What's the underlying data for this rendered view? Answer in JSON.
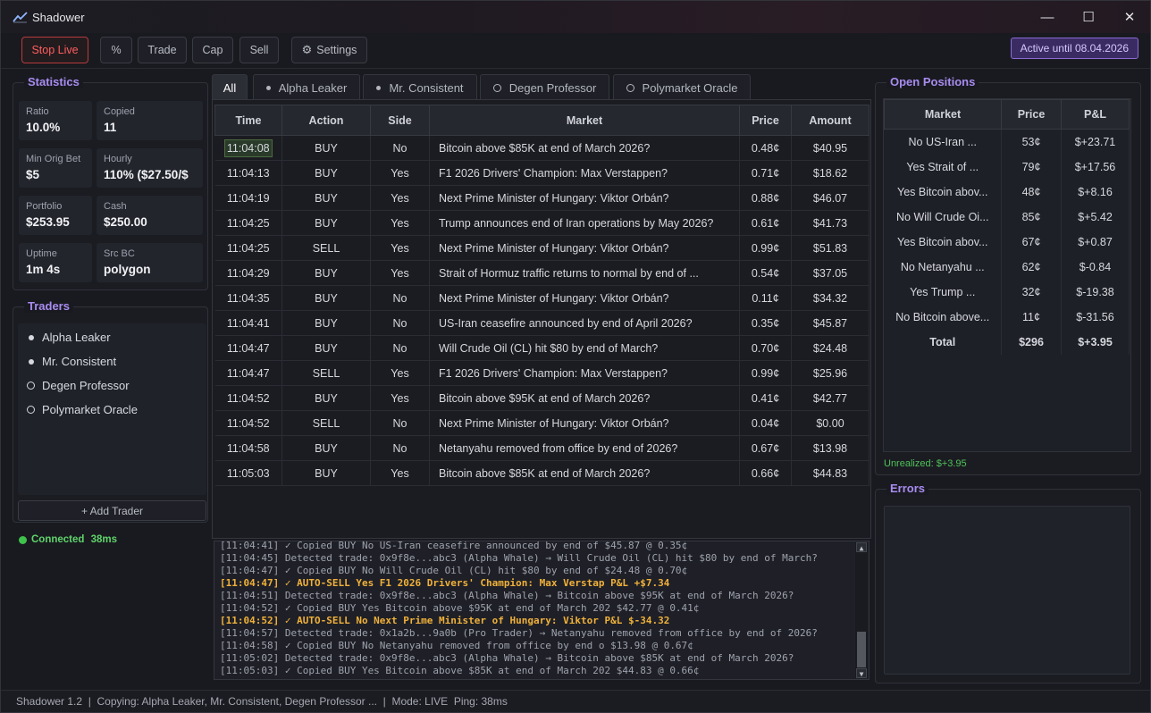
{
  "window": {
    "title": "Shadower",
    "controls": {
      "minimize": "—",
      "maximize": "☐",
      "close": "✕"
    }
  },
  "toolbar": {
    "stop_live": "Stop Live",
    "percent": "%",
    "trade": "Trade",
    "cap": "Cap",
    "sell": "Sell",
    "settings": "Settings",
    "settings_icon": "⚙",
    "active_badge": "Active until 08.04.2026"
  },
  "statistics": {
    "title": "Statistics",
    "items": [
      {
        "label": "Ratio",
        "value": "10.0%"
      },
      {
        "label": "Copied",
        "value": "11"
      },
      {
        "label": "Min Orig Bet",
        "value": "$5"
      },
      {
        "label": "Hourly",
        "value": "110% ($27.50/$"
      },
      {
        "label": "Portfolio",
        "value": "$253.95"
      },
      {
        "label": "Cash",
        "value": "$250.00"
      },
      {
        "label": "Uptime",
        "value": "1m 4s"
      },
      {
        "label": "Src BC",
        "value": "polygon"
      }
    ]
  },
  "traders": {
    "title": "Traders",
    "items": [
      {
        "name": "Alpha Leaker",
        "marker": "filled"
      },
      {
        "name": "Mr. Consistent",
        "marker": "filled"
      },
      {
        "name": "Degen Professor",
        "marker": "ring"
      },
      {
        "name": "Polymarket Oracle",
        "marker": "ring"
      }
    ],
    "add_button": "+ Add Trader"
  },
  "connection": {
    "status": "Connected",
    "ping": "38ms"
  },
  "tabs": [
    {
      "label": "All",
      "marker": "none"
    },
    {
      "label": "Alpha Leaker",
      "marker": "filled"
    },
    {
      "label": "Mr. Consistent",
      "marker": "filled"
    },
    {
      "label": "Degen Professor",
      "marker": "ring"
    },
    {
      "label": "Polymarket Oracle",
      "marker": "ring"
    }
  ],
  "trades": {
    "headers": [
      "Time",
      "Action",
      "Side",
      "Market",
      "Price",
      "Amount"
    ],
    "rows": [
      {
        "time": "11:04:08",
        "action": "BUY",
        "side": "No",
        "market": "Bitcoin above $85K at end of March 2026?",
        "price": "0.48¢",
        "amount": "$40.95"
      },
      {
        "time": "11:04:13",
        "action": "BUY",
        "side": "Yes",
        "market": "F1 2026 Drivers' Champion: Max Verstappen?",
        "price": "0.71¢",
        "amount": "$18.62"
      },
      {
        "time": "11:04:19",
        "action": "BUY",
        "side": "Yes",
        "market": "Next Prime Minister of Hungary: Viktor Orbán?",
        "price": "0.88¢",
        "amount": "$46.07"
      },
      {
        "time": "11:04:25",
        "action": "BUY",
        "side": "Yes",
        "market": "Trump announces end of Iran operations by May 2026?",
        "price": "0.61¢",
        "amount": "$41.73"
      },
      {
        "time": "11:04:25",
        "action": "SELL",
        "side": "Yes",
        "market": "Next Prime Minister of Hungary: Viktor Orbán?",
        "price": "0.99¢",
        "amount": "$51.83"
      },
      {
        "time": "11:04:29",
        "action": "BUY",
        "side": "Yes",
        "market": "Strait of Hormuz traffic returns to normal by end of ...",
        "price": "0.54¢",
        "amount": "$37.05"
      },
      {
        "time": "11:04:35",
        "action": "BUY",
        "side": "No",
        "market": "Next Prime Minister of Hungary: Viktor Orbán?",
        "price": "0.11¢",
        "amount": "$34.32"
      },
      {
        "time": "11:04:41",
        "action": "BUY",
        "side": "No",
        "market": "US-Iran ceasefire announced by end of April 2026?",
        "price": "0.35¢",
        "amount": "$45.87"
      },
      {
        "time": "11:04:47",
        "action": "BUY",
        "side": "No",
        "market": "Will Crude Oil (CL) hit $80 by end of March?",
        "price": "0.70¢",
        "amount": "$24.48"
      },
      {
        "time": "11:04:47",
        "action": "SELL",
        "side": "Yes",
        "market": "F1 2026 Drivers' Champion: Max Verstappen?",
        "price": "0.99¢",
        "amount": "$25.96"
      },
      {
        "time": "11:04:52",
        "action": "BUY",
        "side": "Yes",
        "market": "Bitcoin above $95K at end of March 2026?",
        "price": "0.41¢",
        "amount": "$42.77"
      },
      {
        "time": "11:04:52",
        "action": "SELL",
        "side": "No",
        "market": "Next Prime Minister of Hungary: Viktor Orbán?",
        "price": "0.04¢",
        "amount": "$0.00"
      },
      {
        "time": "11:04:58",
        "action": "BUY",
        "side": "No",
        "market": "Netanyahu removed from office by end of 2026?",
        "price": "0.67¢",
        "amount": "$13.98"
      },
      {
        "time": "11:05:03",
        "action": "BUY",
        "side": "Yes",
        "market": "Bitcoin above $85K at end of March 2026?",
        "price": "0.66¢",
        "amount": "$44.83"
      }
    ]
  },
  "log": [
    {
      "text": "[11:04:41] ✓ Copied BUY No US-Iran ceasefire announced by end of $45.87 @ 0.35¢",
      "highlight": false
    },
    {
      "text": "[11:04:45] Detected trade: 0x9f8e...abc3 (Alpha Whale) → Will Crude Oil (CL) hit $80 by end of March?",
      "highlight": false
    },
    {
      "text": "[11:04:47] ✓ Copied BUY No Will Crude Oil (CL) hit $80 by end of $24.48 @ 0.70¢",
      "highlight": false
    },
    {
      "text": "[11:04:47] ✓ AUTO-SELL Yes F1 2026 Drivers' Champion: Max Verstap P&L +$7.34",
      "highlight": true
    },
    {
      "text": "[11:04:51] Detected trade: 0x9f8e...abc3 (Alpha Whale) → Bitcoin above $95K at end of March 2026?",
      "highlight": false
    },
    {
      "text": "[11:04:52] ✓ Copied BUY Yes Bitcoin above $95K at end of March 202 $42.77 @ 0.41¢",
      "highlight": false
    },
    {
      "text": "[11:04:52] ✓ AUTO-SELL No Next Prime Minister of Hungary: Viktor P&L $-34.32",
      "highlight": true
    },
    {
      "text": "[11:04:57] Detected trade: 0x1a2b...9a0b (Pro Trader) → Netanyahu removed from office by end of 2026?",
      "highlight": false
    },
    {
      "text": "[11:04:58] ✓ Copied BUY No Netanyahu removed from office by end o $13.98 @ 0.67¢",
      "highlight": false
    },
    {
      "text": "[11:05:02] Detected trade: 0x9f8e...abc3 (Alpha Whale) → Bitcoin above $85K at end of March 2026?",
      "highlight": false
    },
    {
      "text": "[11:05:03] ✓ Copied BUY Yes Bitcoin above $85K at end of March 202 $44.83 @ 0.66¢",
      "highlight": false
    }
  ],
  "open_positions": {
    "title": "Open Positions",
    "headers": [
      "Market",
      "Price",
      "P&L"
    ],
    "rows": [
      {
        "market": "No US-Iran ...",
        "price": "53¢",
        "pnl": "$+23.71",
        "trend": "up"
      },
      {
        "market": "Yes Strait of ...",
        "price": "79¢",
        "pnl": "$+17.56",
        "trend": "up"
      },
      {
        "market": "Yes Bitcoin abov...",
        "price": "48¢",
        "pnl": "$+8.16",
        "trend": "up"
      },
      {
        "market": "No Will Crude Oi...",
        "price": "85¢",
        "pnl": "$+5.42",
        "trend": "up"
      },
      {
        "market": "Yes Bitcoin abov...",
        "price": "67¢",
        "pnl": "$+0.87",
        "trend": "up"
      },
      {
        "market": "No Netanyahu ...",
        "price": "62¢",
        "pnl": "$-0.84",
        "trend": "down"
      },
      {
        "market": "Yes Trump ...",
        "price": "32¢",
        "pnl": "$-19.38",
        "trend": "down"
      },
      {
        "market": "No Bitcoin above...",
        "price": "11¢",
        "pnl": "$-31.56",
        "trend": "down"
      }
    ],
    "total": {
      "label": "Total",
      "price": "$296",
      "pnl": "$+3.95"
    },
    "unrealized": "Unrealized: $+3.95"
  },
  "errors": {
    "title": "Errors"
  },
  "statusbar": {
    "text": "Shadower 1.2  |  Copying: Alpha Leaker, Mr. Consistent, Degen Professor ...  |  Mode: LIVE  Ping: 38ms"
  },
  "colors": {
    "accent": "#a88cf0",
    "buy": "#4fc25a",
    "sell": "#ef4b4b",
    "autosell": "#f0b13a"
  }
}
